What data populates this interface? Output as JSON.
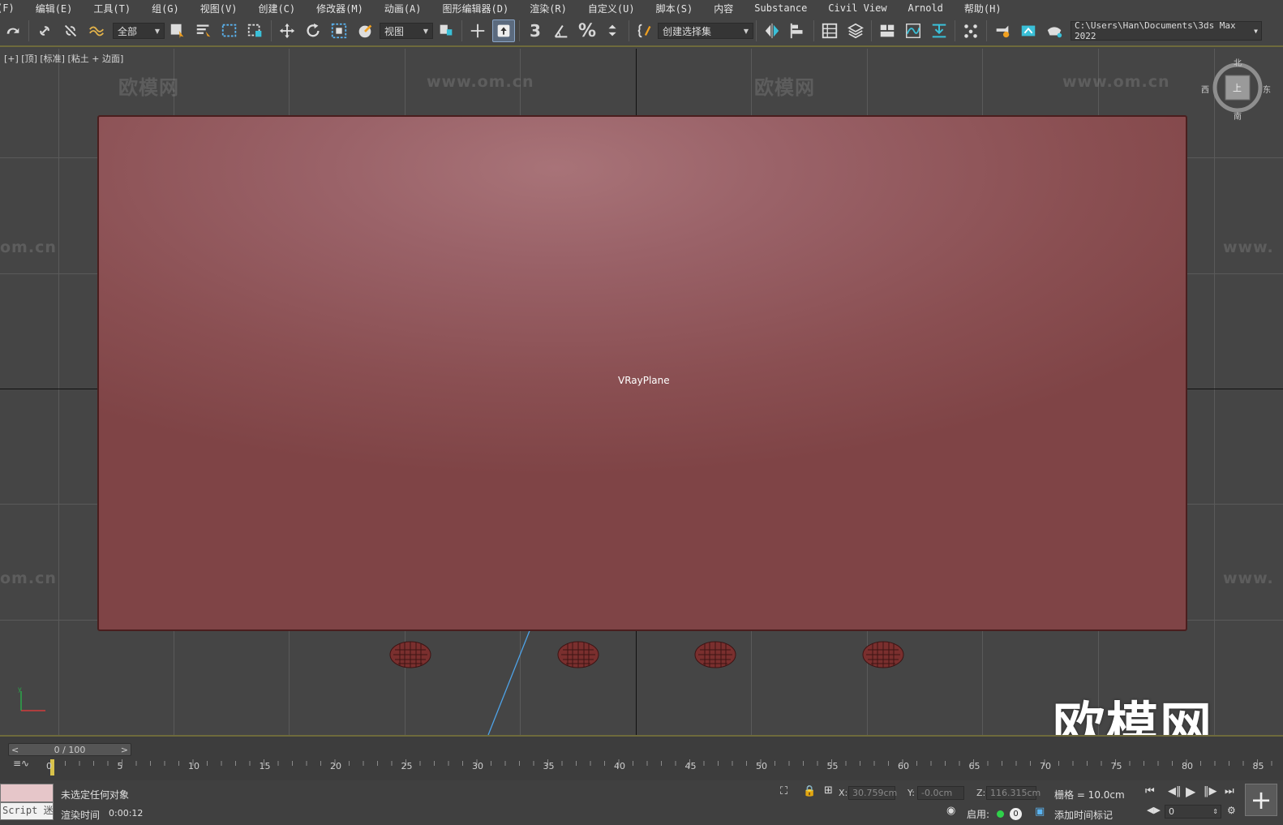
{
  "menubar": {
    "items": [
      "(F)",
      "编辑(E)",
      "工具(T)",
      "组(G)",
      "视图(V)",
      "创建(C)",
      "修改器(M)",
      "动画(A)",
      "图形编辑器(D)",
      "渲染(R)",
      "自定义(U)",
      "脚本(S)",
      "内容",
      "Substance",
      "Civil View",
      "Arnold",
      "帮助(H)"
    ]
  },
  "toolbar": {
    "selection_filter": "全部",
    "reference_coord": "视图",
    "named_selection_set": "创建选择集",
    "project_path": "C:\\Users\\Han\\Documents\\3ds Max 2022",
    "snap_label": "3"
  },
  "viewport": {
    "label": "[+] [顶] [标准] [粘土 + 边面]",
    "object_label": "VRayPlane",
    "viewcube": {
      "north": "北",
      "south": "南",
      "west": "西",
      "east": "东",
      "face": "上"
    },
    "watermark_cn": "欧模网",
    "watermark_url": "www.om.cn",
    "watermark_url_partial": "om.cn",
    "watermark_url_partial_right": "www.",
    "big_watermark": "欧模网",
    "plane_color": "#955a5e",
    "selection_line_color": "#4ea3e8"
  },
  "timeline": {
    "frame_display": "0 / 100",
    "prev": "<",
    "next": ">",
    "ruler_labels": [
      "0",
      "5",
      "10",
      "15",
      "20",
      "25",
      "30",
      "35",
      "40",
      "45",
      "50",
      "55",
      "60",
      "65",
      "70",
      "75",
      "80",
      "85"
    ]
  },
  "status": {
    "listener_text": "Script 迷",
    "selection_msg": "未选定任何对象",
    "render_time_label": "渲染时间",
    "render_time_value": "0:00:12",
    "x_label": "X:",
    "x_value": "30.759cm",
    "y_label": "Y:",
    "y_value": "-0.0cm",
    "z_label": "Z:",
    "z_value": "116.315cm",
    "grid_label": "栅格 = 10.0cm",
    "enable_label": "启用:",
    "zero_badge": "0",
    "add_time_tag": "添加时间标记",
    "current_frame": "0",
    "accent_green": "#2fd14a"
  }
}
